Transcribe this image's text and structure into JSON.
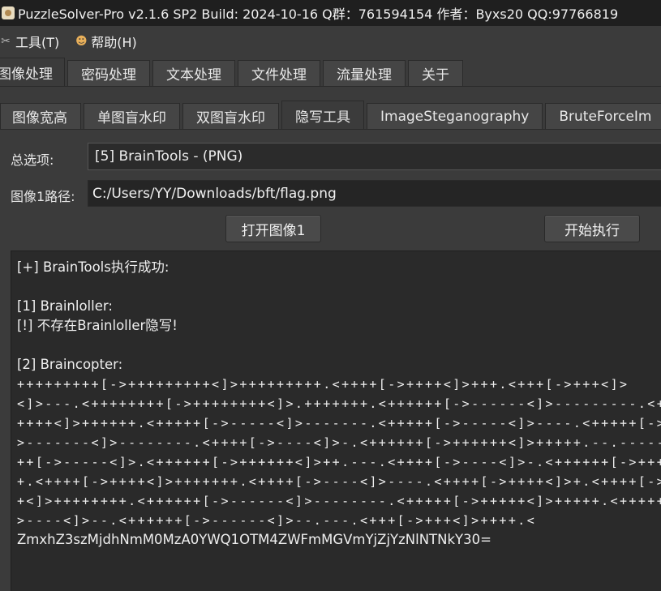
{
  "window": {
    "title": "PuzzleSolver-Pro v2.1.6 SP2  Build: 2024-10-16  Q群：761594154  作者：Byxs20  QQ:97766819"
  },
  "menubar": {
    "items": [
      {
        "label": "工具(T)",
        "icon": "tools-icon"
      },
      {
        "label": "帮助(H)",
        "icon": "help-icon"
      }
    ]
  },
  "main_tabs": [
    "图像处理",
    "密码处理",
    "文本处理",
    "文件处理",
    "流量处理",
    "关于"
  ],
  "main_tab_active": "图像处理",
  "sub_tabs": [
    "图像宽高",
    "单图盲水印",
    "双图盲水印",
    "隐写工具",
    "ImageSteganography",
    "BruteForceIm"
  ],
  "sub_tab_active": "隐写工具",
  "options": {
    "label": "总选项:",
    "selected": "[5] BrainTools - (PNG)"
  },
  "image_path": {
    "label": "图像1路径:",
    "value": "C:/Users/YY/Downloads/bft/flag.png"
  },
  "buttons": {
    "open_image": "打开图像1",
    "start": "开始执行"
  },
  "output": {
    "lines": [
      "[+] BrainTools执行成功:",
      "",
      "[1] Brainloller:",
      "[!] 不存在Brainloller隐写!",
      "",
      "[2] Braincopter:",
      "+++++++++[->+++++++++<]>+++++++++.<++++[->++++<]>+++.<+++[->+++<]>",
      "<]>---.<++++++++[->++++++++<]>.+++++++.<++++++[->------<]>---------.<+++++",
      "++++<]>++++++.<+++++[->-----<]>-------.<+++++[->-----<]>----.<+++++[->+++++",
      ">-------<]>--------.<++++[->----<]>-.<++++++[->++++++<]>+++++.--.------.<+++++",
      "++[->-----<]>.<++++++[->++++++<]>++.---.<++++[->----<]>-.<++++++[->+++++++",
      "+.<++++[->++++<]>+++++++.<++++[->----<]>----.<++++[->++++<]>+.<++++[->---",
      "+<]>++++++++.<++++++[->------<]>--------.<+++++[->+++++<]>+++++.<+++++[-",
      ">----<]>--.<++++++[->------<]>--.---.<+++[->+++<]>++++.<",
      "ZmxhZ3szMjdhNmM0MzA0YWQ1OTM4ZWFmMGVmYjZjYzNlNTNkY30="
    ],
    "mono_from": 6,
    "mono_to": 13
  }
}
